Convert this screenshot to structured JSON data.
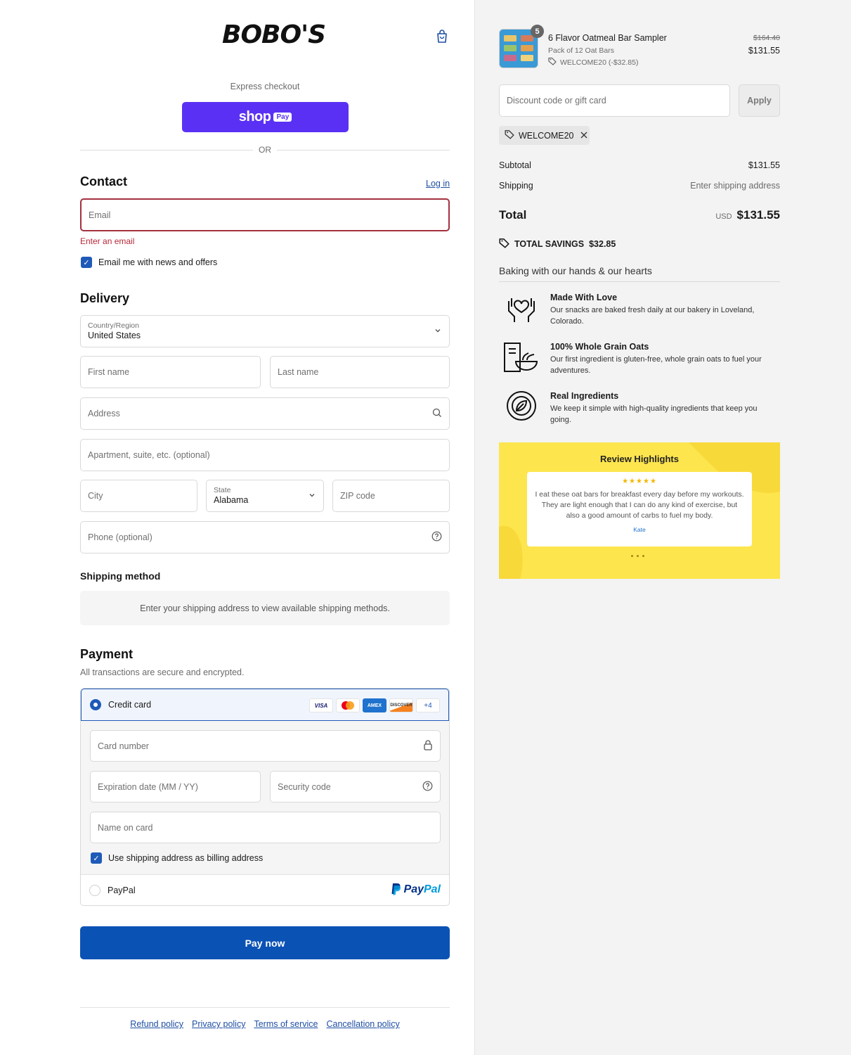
{
  "brand": {
    "logo_text": "BOBO'S"
  },
  "express": {
    "label": "Express checkout",
    "shop_text": "shop",
    "pay_text": "Pay",
    "or_text": "OR"
  },
  "contact": {
    "title": "Contact",
    "login_link": "Log in",
    "email_placeholder": "Email",
    "email_error": "Enter an email",
    "newsletter_label": "Email me with news and offers",
    "newsletter_checked": true
  },
  "delivery": {
    "title": "Delivery",
    "country_label": "Country/Region",
    "country_value": "United States",
    "first_name": "First name",
    "last_name": "Last name",
    "address": "Address",
    "apartment": "Apartment, suite, etc. (optional)",
    "city": "City",
    "state_label": "State",
    "state_value": "Alabama",
    "zip": "ZIP code",
    "phone": "Phone (optional)"
  },
  "shipping_method": {
    "title": "Shipping method",
    "message": "Enter your shipping address to view available shipping methods."
  },
  "payment": {
    "title": "Payment",
    "subtitle": "All transactions are secure and encrypted.",
    "credit_card_label": "Credit card",
    "card_brands": [
      "VISA",
      "MC",
      "AMEX",
      "DISCOVER"
    ],
    "more_cards": "+4",
    "card_number": "Card number",
    "expiration": "Expiration date (MM / YY)",
    "security_code": "Security code",
    "name_on_card": "Name on card",
    "billing_same_label": "Use shipping address as billing address",
    "paypal_label": "PayPal",
    "paypal_logo_p": "Pay",
    "paypal_logo_pal": "Pal"
  },
  "pay_now": "Pay now",
  "footer_links": [
    "Refund policy",
    "Privacy policy",
    "Terms of service",
    "Cancellation policy"
  ],
  "summary": {
    "product": {
      "quantity": "5",
      "name": "6 Flavor Oatmeal Bar Sampler",
      "variant": "Pack of 12 Oat Bars",
      "discount": "WELCOME20 (-$32.85)",
      "original_price": "$164.40",
      "price": "$131.55"
    },
    "discount_placeholder": "Discount code or gift card",
    "apply_label": "Apply",
    "applied_code": "WELCOME20",
    "subtotal_label": "Subtotal",
    "subtotal_value": "$131.55",
    "shipping_label": "Shipping",
    "shipping_value": "Enter shipping address",
    "total_label": "Total",
    "currency": "USD",
    "total_value": "$131.55",
    "savings_label": "TOTAL SAVINGS",
    "savings_value": "$32.85"
  },
  "features": {
    "heading": "Baking with our hands & our hearts",
    "items": [
      {
        "title": "Made With Love",
        "desc": "Our snacks are baked fresh daily at our bakery in Loveland, Colorado."
      },
      {
        "title": "100% Whole Grain Oats",
        "desc": "Our first ingredient is gluten-free, whole grain oats to fuel your adventures."
      },
      {
        "title": "Real Ingredients",
        "desc": "We keep it simple with high-quality ingredients that keep you going."
      }
    ]
  },
  "review": {
    "title": "Review Highlights",
    "stars": "★★★★★",
    "text": "I eat these oat bars for breakfast every day before my workouts. They are light enough that I can do any kind of exercise, but also a good amount of carbs to fuel my body.",
    "author": "Kate"
  },
  "colors": {
    "accent": "#1f5ab8",
    "shop_pay": "#5a31f4",
    "pay_button": "#0b52b5",
    "error": "#a4313f",
    "review_bg": "#fde54e"
  }
}
